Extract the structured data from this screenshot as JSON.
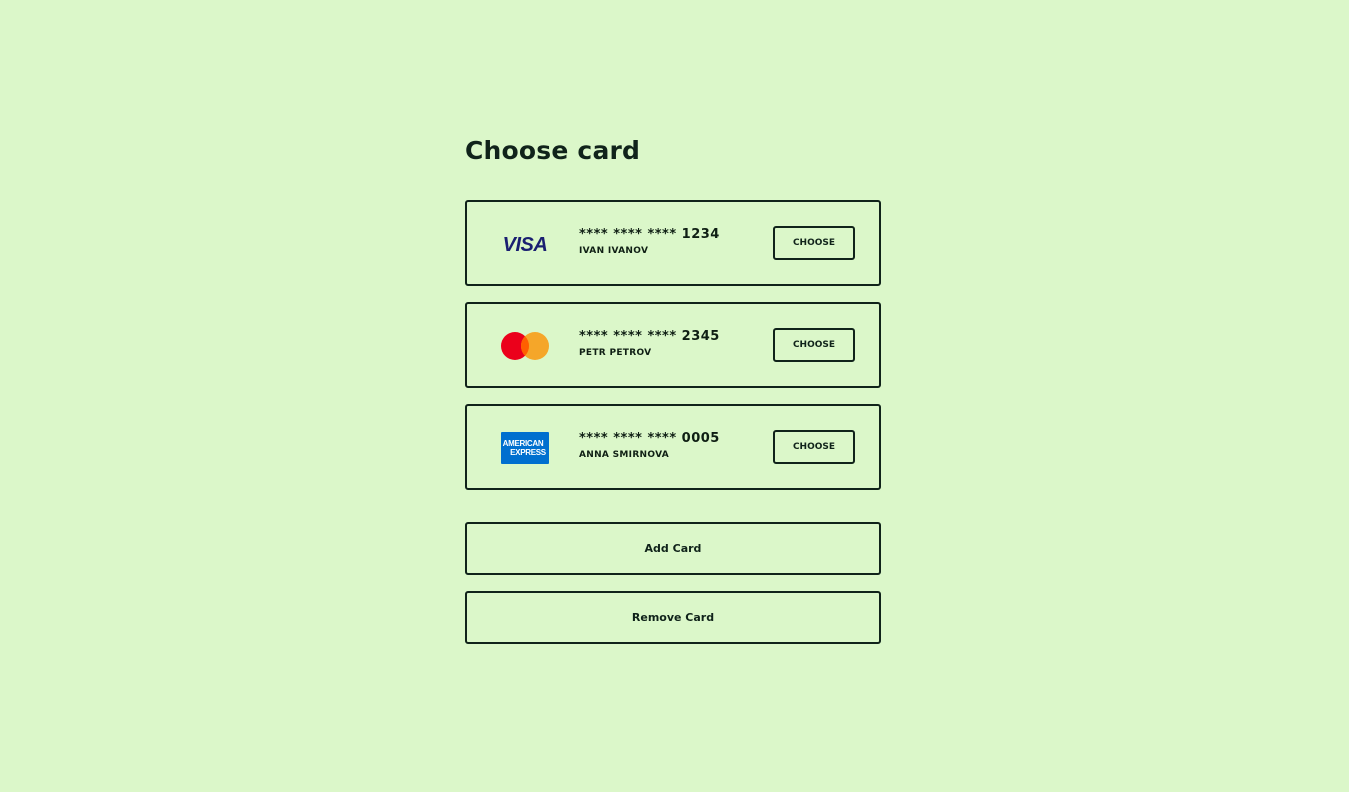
{
  "page": {
    "title": "Choose card"
  },
  "cards": [
    {
      "brand": "visa",
      "brand_icon": "visa-logo-icon",
      "number": "**** **** **** 1234",
      "holder": "Ivan Ivanov",
      "choose_label": "Choose"
    },
    {
      "brand": "mastercard",
      "brand_icon": "mastercard-logo-icon",
      "number": "**** **** **** 2345",
      "holder": "Petr Petrov",
      "choose_label": "Choose"
    },
    {
      "brand": "amex",
      "brand_icon": "american-express-logo-icon",
      "logo_text": [
        "AMERICAN",
        "EXPRESS"
      ],
      "number": "**** **** **** 0005",
      "holder": "Anna Smirnova",
      "choose_label": "Choose"
    }
  ],
  "actions": {
    "add_label": "Add Card",
    "remove_label": "Remove Card"
  },
  "colors": {
    "background": "#dbf7c9",
    "ink": "#10231a",
    "visa_blue": "#1a1f71",
    "mastercard_red": "#eb001b",
    "mastercard_orange": "#f79e1b",
    "amex_blue": "#006fcf"
  }
}
